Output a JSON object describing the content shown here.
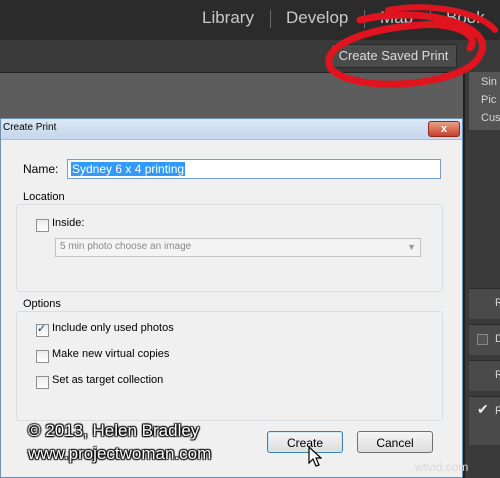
{
  "modules": [
    "Library",
    "Develop",
    "Map",
    "Book"
  ],
  "toolbar": {
    "saved_print_label": "Create Saved Print"
  },
  "right_panel": {
    "items": [
      "Sin",
      "Pic",
      "Cus"
    ],
    "rows": [
      "R",
      "D",
      "R",
      "R"
    ]
  },
  "dialog": {
    "title": "Create Print",
    "close_label": "x",
    "name_label": "Name:",
    "name_value": "Sydney 6 x 4 printing",
    "location_label": "Location",
    "inside_label": "Inside:",
    "inside_combo_value": "5 min photo choose an image",
    "options_label": "Options",
    "options": [
      {
        "label": "Include only used photos",
        "checked": true
      },
      {
        "label": "Make new virtual copies",
        "checked": false
      },
      {
        "label": "Set as target collection",
        "checked": false
      }
    ],
    "create_label": "Create",
    "cancel_label": "Cancel"
  },
  "watermark": {
    "line1": "© 2013, Helen Bradley",
    "line2": "www.projectwoman.com"
  },
  "site_watermark": "wtvid.com"
}
